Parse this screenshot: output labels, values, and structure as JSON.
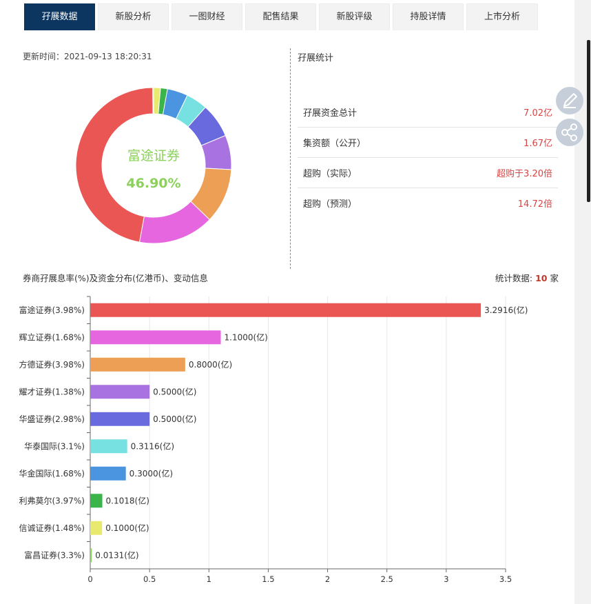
{
  "tabs": [
    {
      "label": "孖展数据",
      "active": true
    },
    {
      "label": "新股分析",
      "active": false
    },
    {
      "label": "一图财经",
      "active": false
    },
    {
      "label": "配售结果",
      "active": false
    },
    {
      "label": "新股评级",
      "active": false
    },
    {
      "label": "持股详情",
      "active": false
    },
    {
      "label": "上市分析",
      "active": false
    }
  ],
  "update": {
    "label": "更新时间：",
    "value": "2021-09-13 18:20:31"
  },
  "stats": {
    "title": "孖展统计",
    "rows": [
      {
        "label": "孖展资金总计",
        "value": "7.02亿"
      },
      {
        "label": "集资额（公开）",
        "value": "1.67亿"
      },
      {
        "label": "超购（实际）",
        "value": "超购于3.20倍"
      },
      {
        "label": "超购（预测）",
        "value": "14.72倍"
      }
    ]
  },
  "donut": {
    "center_name": "富途证券",
    "center_pct": "46.90%",
    "center_color": "#8bd15a",
    "segments": [
      {
        "name": "信诚证券",
        "value": 0.1,
        "color": "#e8ea6f"
      },
      {
        "name": "利弗莫尔",
        "value": 0.1018,
        "color": "#3bb54a"
      },
      {
        "name": "华金国际",
        "value": 0.3,
        "color": "#4a94e0"
      },
      {
        "name": "华泰国际",
        "value": 0.3116,
        "color": "#77e1e1"
      },
      {
        "name": "华盛证券",
        "value": 0.5,
        "color": "#6a6adf"
      },
      {
        "name": "耀才证券",
        "value": 0.5,
        "color": "#a872e1"
      },
      {
        "name": "方德证券",
        "value": 0.8,
        "color": "#ee9f56"
      },
      {
        "name": "辉立证券",
        "value": 1.1,
        "color": "#e666e0"
      },
      {
        "name": "富途证券",
        "value": 3.2916,
        "color": "#ea5654"
      },
      {
        "name": "富昌证券",
        "value": 0.0131,
        "color": "#8bd15a"
      }
    ]
  },
  "section": {
    "title": "券商孖展息率(%)及资金分布(亿港币)、变动信息",
    "count_label": "统计数据:",
    "count_value": "10",
    "count_unit": "家"
  },
  "chart_data": {
    "type": "bar",
    "orientation": "horizontal",
    "categories": [
      "富途证券(3.98%)",
      "辉立证券(1.68%)",
      "方德证券(3.98%)",
      "耀才证券(1.38%)",
      "华盛证券(2.98%)",
      "华泰国际(3.1%)",
      "华金国际(1.68%)",
      "利弗莫尔(3.97%)",
      "信诚证券(1.48%)",
      "富昌证券(3.3%)"
    ],
    "values": [
      3.2916,
      1.1,
      0.8,
      0.5,
      0.5,
      0.3116,
      0.3,
      0.1018,
      0.1,
      0.0131
    ],
    "value_labels": [
      "3.2916(亿)",
      "1.1000(亿)",
      "0.8000(亿)",
      "0.5000(亿)",
      "0.5000(亿)",
      "0.3116(亿)",
      "0.3000(亿)",
      "0.1018(亿)",
      "0.1000(亿)",
      "0.0131(亿)"
    ],
    "colors": [
      "#ea5654",
      "#e666e0",
      "#ee9f56",
      "#a872e1",
      "#6a6adf",
      "#77e1e1",
      "#4a94e0",
      "#3bb54a",
      "#e8ea6f",
      "#8bd15a"
    ],
    "xticks": [
      0,
      0.5,
      1,
      1.5,
      2,
      2.5,
      3,
      3.5
    ],
    "xtick_labels": [
      "0",
      "0.5",
      "1",
      "1.5",
      "2",
      "2.5",
      "3",
      "3.5"
    ],
    "xlim": [
      0,
      3.5
    ],
    "grid": true
  },
  "side_buttons": [
    {
      "icon": "edit-icon"
    },
    {
      "icon": "share-icon"
    }
  ]
}
